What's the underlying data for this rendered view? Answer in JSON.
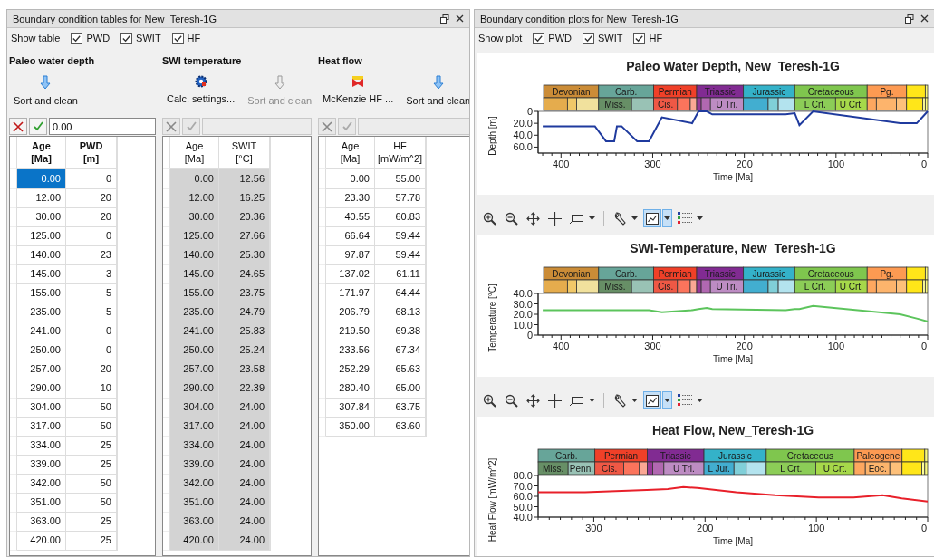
{
  "tables_panel": {
    "title": "Boundary condition tables for New_Teresh-1G",
    "show_label": "Show table",
    "toggles": [
      {
        "label": "PWD",
        "checked": true
      },
      {
        "label": "SWIT",
        "checked": true
      },
      {
        "label": "HF",
        "checked": true
      }
    ],
    "sections": [
      {
        "title": "Paleo water depth",
        "active": true,
        "readonly": false,
        "edit_value": "0.00",
        "buttons": [
          {
            "kind": "sort",
            "label": "Sort and clean",
            "disabled": false
          }
        ],
        "columns": [
          "Age\n[Ma]",
          "PWD\n[m]"
        ],
        "rows": [
          {
            "age": "0.00",
            "value": "0",
            "selected": true
          },
          {
            "age": "12.00",
            "value": "20",
            "selected": false
          },
          {
            "age": "30.00",
            "value": "20",
            "selected": false
          },
          {
            "age": "125.00",
            "value": "0",
            "selected": false
          },
          {
            "age": "140.00",
            "value": "23",
            "selected": false
          },
          {
            "age": "145.00",
            "value": "3",
            "selected": false
          },
          {
            "age": "155.00",
            "value": "5",
            "selected": false
          },
          {
            "age": "235.00",
            "value": "5",
            "selected": false
          },
          {
            "age": "241.00",
            "value": "0",
            "selected": false
          },
          {
            "age": "250.00",
            "value": "0",
            "selected": false
          },
          {
            "age": "257.00",
            "value": "20",
            "selected": false
          },
          {
            "age": "290.00",
            "value": "10",
            "selected": false
          },
          {
            "age": "304.00",
            "value": "50",
            "selected": false
          },
          {
            "age": "317.00",
            "value": "50",
            "selected": false
          },
          {
            "age": "334.00",
            "value": "25",
            "selected": false
          },
          {
            "age": "339.00",
            "value": "25",
            "selected": false
          },
          {
            "age": "342.00",
            "value": "50",
            "selected": false
          },
          {
            "age": "351.00",
            "value": "50",
            "selected": false
          },
          {
            "age": "363.00",
            "value": "25",
            "selected": false
          },
          {
            "age": "420.00",
            "value": "25",
            "selected": false
          }
        ]
      },
      {
        "title": "SWI temperature",
        "active": false,
        "readonly": true,
        "buttons": [
          {
            "kind": "settings",
            "label": "Calc. settings...",
            "disabled": false
          },
          {
            "kind": "sort",
            "label": "Sort and clean",
            "disabled": true
          }
        ],
        "columns": [
          "Age\n[Ma]",
          "SWIT\n[°C]"
        ],
        "rows": [
          {
            "age": "0.00",
            "value": "12.56",
            "selected": false
          },
          {
            "age": "12.00",
            "value": "16.25",
            "selected": false
          },
          {
            "age": "30.00",
            "value": "20.36",
            "selected": false
          },
          {
            "age": "125.00",
            "value": "27.66",
            "selected": false
          },
          {
            "age": "140.00",
            "value": "25.30",
            "selected": false
          },
          {
            "age": "145.00",
            "value": "24.65",
            "selected": false
          },
          {
            "age": "155.00",
            "value": "23.75",
            "selected": false
          },
          {
            "age": "235.00",
            "value": "24.79",
            "selected": false
          },
          {
            "age": "241.00",
            "value": "25.83",
            "selected": false
          },
          {
            "age": "250.00",
            "value": "25.24",
            "selected": false
          },
          {
            "age": "257.00",
            "value": "23.58",
            "selected": false
          },
          {
            "age": "290.00",
            "value": "22.39",
            "selected": false
          },
          {
            "age": "304.00",
            "value": "24.00",
            "selected": false
          },
          {
            "age": "317.00",
            "value": "24.00",
            "selected": false
          },
          {
            "age": "334.00",
            "value": "24.00",
            "selected": false
          },
          {
            "age": "339.00",
            "value": "24.00",
            "selected": false
          },
          {
            "age": "342.00",
            "value": "24.00",
            "selected": false
          },
          {
            "age": "351.00",
            "value": "24.00",
            "selected": false
          },
          {
            "age": "363.00",
            "value": "24.00",
            "selected": false
          },
          {
            "age": "420.00",
            "value": "24.00",
            "selected": false
          }
        ]
      },
      {
        "title": "Heat flow",
        "active": false,
        "readonly": false,
        "buttons": [
          {
            "kind": "mckenzie",
            "label": "McKenzie HF ...",
            "disabled": false
          },
          {
            "kind": "sort",
            "label": "Sort and clean",
            "disabled": false
          }
        ],
        "columns": [
          "Age\n[Ma]",
          "HF\n[mW/m^2]"
        ],
        "rows": [
          {
            "age": "0.00",
            "value": "55.00",
            "selected": false
          },
          {
            "age": "23.30",
            "value": "57.78",
            "selected": false
          },
          {
            "age": "40.55",
            "value": "60.83",
            "selected": false
          },
          {
            "age": "66.64",
            "value": "59.44",
            "selected": false
          },
          {
            "age": "97.87",
            "value": "59.44",
            "selected": false
          },
          {
            "age": "137.02",
            "value": "61.11",
            "selected": false
          },
          {
            "age": "171.97",
            "value": "64.44",
            "selected": false
          },
          {
            "age": "206.79",
            "value": "68.13",
            "selected": false
          },
          {
            "age": "219.50",
            "value": "69.38",
            "selected": false
          },
          {
            "age": "233.56",
            "value": "67.34",
            "selected": false
          },
          {
            "age": "252.29",
            "value": "65.63",
            "selected": false
          },
          {
            "age": "280.40",
            "value": "65.00",
            "selected": false
          },
          {
            "age": "307.84",
            "value": "63.75",
            "selected": false
          },
          {
            "age": "350.00",
            "value": "63.60",
            "selected": false
          }
        ]
      }
    ]
  },
  "plots_panel": {
    "title": "Boundary condition plots for New_Teresh-1G",
    "show_label": "Show plot",
    "toggles": [
      {
        "label": "PWD",
        "checked": true
      },
      {
        "label": "SWIT",
        "checked": true
      },
      {
        "label": "HF",
        "checked": true
      }
    ],
    "charts": [
      {
        "title": "Paleo Water Depth, New_Teresh-1G",
        "timescale": {
          "periods": [
            {
              "kind": "dev",
              "label": "Devonian",
              "color": "#cb8c37"
            },
            {
              "kind": "carb",
              "label": "Carb.",
              "color": "#67a599"
            },
            {
              "kind": "perm",
              "label": "Permian",
              "color": "#f04028"
            },
            {
              "kind": "trias",
              "label": "Triassic",
              "color": "#812b92"
            },
            {
              "kind": "jura",
              "label": "Jurassic",
              "color": "#34b2c9"
            },
            {
              "kind": "creta",
              "label": "Cretaceous",
              "color": "#7fc64e"
            },
            {
              "kind": "paleog",
              "label": "Pg.",
              "color": "#fd9a52"
            },
            {
              "kind": "neog",
              "color": "#ffe619"
            },
            {
              "kind": "quat",
              "color": "#f9f97f"
            }
          ],
          "epochs": [
            {
              "kind": "devl",
              "color": "#e5ac4d"
            },
            {
              "kind": "devm",
              "color": "#f1c868"
            },
            {
              "kind": "devu",
              "color": "#f1e19d"
            },
            {
              "kind": "miss",
              "label": "Miss.",
              "color": "#678f66"
            },
            {
              "kind": "penn",
              "color": "#99c2b5"
            },
            {
              "kind": "cisu",
              "label": "Cis.",
              "color": "#ef5845"
            },
            {
              "kind": "guad",
              "color": "#fb745c"
            },
            {
              "kind": "lopi",
              "color": "#fba794"
            },
            {
              "kind": "tril",
              "color": "#983999"
            },
            {
              "kind": "trim",
              "color": "#b168b1"
            },
            {
              "kind": "triu",
              "label": "U Tri.",
              "color": "#bd8cc3"
            },
            {
              "kind": "jurl",
              "color": "#42aed0"
            },
            {
              "kind": "jurm",
              "color": "#80cfd8"
            },
            {
              "kind": "juru",
              "color": "#b3e3ee"
            },
            {
              "kind": "crel",
              "label": "L Crt.",
              "color": "#8ccd57"
            },
            {
              "kind": "creu",
              "label": "U Crt.",
              "color": "#a6d84a"
            },
            {
              "kind": "paleoc",
              "color": "#fda75f"
            },
            {
              "kind": "eoc",
              "color": "#fdb46c"
            },
            {
              "kind": "olig",
              "color": "#fdc07a"
            },
            {
              "kind": "mioc",
              "color": "#ffe619"
            },
            {
              "kind": "plioc",
              "color": "#ffff99"
            },
            {
              "kind": "quat",
              "color": "#f9f97f"
            }
          ]
        },
        "chart_data": {
          "type": "line",
          "xlabel": "Time [Ma]",
          "ylabel": "Depth [m]",
          "x": [
            0,
            12,
            30,
            125,
            140,
            145,
            155,
            235,
            241,
            250,
            257,
            290,
            304,
            317,
            334,
            339,
            342,
            351,
            363,
            420
          ],
          "series": [
            {
              "color": "#1f3a9e",
              "values": [
                0,
                20,
                20,
                0,
                23,
                3,
                5,
                5,
                0,
                0,
                20,
                10,
                50,
                50,
                25,
                25,
                50,
                50,
                25,
                25
              ]
            }
          ],
          "xlim": [
            425,
            0
          ],
          "ylim": [
            70,
            0
          ],
          "xticks": [
            400,
            300,
            200,
            100,
            0
          ],
          "yticks": [
            0,
            {
              "value": 20,
              "label": "20.0"
            },
            {
              "value": 40,
              "label": "40.0"
            },
            {
              "value": 60,
              "label": "60.0"
            }
          ]
        }
      },
      {
        "title": "SWI-Temperature, New_Teresh-1G",
        "toolbar": [
          {
            "kind": "zoom_in",
            "selected": false
          },
          {
            "kind": "zoom_out",
            "selected": false
          },
          {
            "kind": "pan",
            "selected": false
          },
          {
            "kind": "crosshair",
            "selected": false
          },
          {
            "kind": "rectangle",
            "selected": false,
            "dropdown": true
          },
          {
            "kind": "tool",
            "selected": false,
            "dropdown": true
          },
          {
            "kind": "chart",
            "selected": true,
            "dropdown": true
          },
          {
            "kind": "legend",
            "selected": false,
            "dropdown": true
          }
        ],
        "timescale": {
          "periods": [
            {
              "kind": "dev",
              "label": "Devonian",
              "color": "#cb8c37"
            },
            {
              "kind": "carb",
              "label": "Carb.",
              "color": "#67a599"
            },
            {
              "kind": "perm",
              "label": "Permian",
              "color": "#f04028"
            },
            {
              "kind": "trias",
              "label": "Triassic",
              "color": "#812b92"
            },
            {
              "kind": "jura",
              "label": "Jurassic",
              "color": "#34b2c9"
            },
            {
              "kind": "creta",
              "label": "Cretaceous",
              "color": "#7fc64e"
            },
            {
              "kind": "paleog",
              "label": "Pg.",
              "color": "#fd9a52"
            },
            {
              "kind": "neog",
              "color": "#ffe619"
            },
            {
              "kind": "quat",
              "color": "#f9f97f"
            }
          ],
          "epochs": [
            {
              "kind": "devl",
              "color": "#e5ac4d"
            },
            {
              "kind": "devm",
              "color": "#f1c868"
            },
            {
              "kind": "devu",
              "color": "#f1e19d"
            },
            {
              "kind": "miss",
              "label": "Miss.",
              "color": "#678f66"
            },
            {
              "kind": "penn",
              "color": "#99c2b5"
            },
            {
              "kind": "cisu",
              "label": "Cis.",
              "color": "#ef5845"
            },
            {
              "kind": "guad",
              "color": "#fb745c"
            },
            {
              "kind": "lopi",
              "color": "#fba794"
            },
            {
              "kind": "tril",
              "color": "#983999"
            },
            {
              "kind": "trim",
              "color": "#b168b1"
            },
            {
              "kind": "triu",
              "label": "U Tri.",
              "color": "#bd8cc3"
            },
            {
              "kind": "jurl",
              "color": "#42aed0"
            },
            {
              "kind": "jurm",
              "color": "#80cfd8"
            },
            {
              "kind": "juru",
              "color": "#b3e3ee"
            },
            {
              "kind": "crel",
              "label": "L Crt.",
              "color": "#8ccd57"
            },
            {
              "kind": "creu",
              "label": "U Crt.",
              "color": "#a6d84a"
            },
            {
              "kind": "paleoc",
              "color": "#fda75f"
            },
            {
              "kind": "eoc",
              "color": "#fdb46c"
            },
            {
              "kind": "olig",
              "color": "#fdc07a"
            },
            {
              "kind": "mioc",
              "color": "#ffe619"
            },
            {
              "kind": "plioc",
              "color": "#ffff99"
            },
            {
              "kind": "quat",
              "color": "#f9f97f"
            }
          ]
        },
        "chart_data": {
          "type": "line",
          "xlabel": "Time [Ma]",
          "ylabel": "Temperature [°C]",
          "x": [
            0,
            12,
            30,
            125,
            140,
            145,
            155,
            235,
            241,
            250,
            257,
            290,
            304,
            317,
            334,
            339,
            342,
            351,
            363,
            420
          ],
          "series": [
            {
              "color": "#5cc45c",
              "values": [
                13,
                16,
                20,
                28,
                25,
                25,
                24,
                25,
                26,
                25,
                24,
                22,
                24,
                24,
                24,
                24,
                24,
                24,
                24,
                24
              ]
            }
          ],
          "xlim": [
            425,
            0
          ],
          "ylim": [
            0,
            40
          ],
          "xticks": [
            400,
            300,
            200,
            100,
            0
          ],
          "yticks": [
            0,
            {
              "value": 10,
              "label": "10.0"
            },
            {
              "value": 20,
              "label": "20.0"
            },
            {
              "value": 30,
              "label": "30.0"
            },
            {
              "value": 40,
              "label": "40.0"
            }
          ]
        }
      },
      {
        "title": "Heat Flow, New_Teresh-1G",
        "toolbar": [
          {
            "kind": "zoom_in",
            "selected": false
          },
          {
            "kind": "zoom_out",
            "selected": false
          },
          {
            "kind": "pan",
            "selected": false
          },
          {
            "kind": "crosshair",
            "selected": false
          },
          {
            "kind": "rectangle",
            "selected": false,
            "dropdown": true
          },
          {
            "kind": "tool",
            "selected": false,
            "dropdown": true
          },
          {
            "kind": "chart",
            "selected": true,
            "dropdown": true
          },
          {
            "kind": "legend",
            "selected": false,
            "dropdown": true
          }
        ],
        "timescale": {
          "periods": [
            {
              "kind": "carb",
              "label": "Carb.",
              "color": "#67a599"
            },
            {
              "kind": "perm",
              "label": "Permian",
              "color": "#f04028"
            },
            {
              "kind": "trias",
              "label": "Triassic",
              "color": "#812b92"
            },
            {
              "kind": "jura",
              "label": "Jurassic",
              "color": "#34b2c9"
            },
            {
              "kind": "creta",
              "label": "Cretaceous",
              "color": "#7fc64e"
            },
            {
              "kind": "paleog",
              "label": "Paleogene",
              "color": "#fd9a52"
            },
            {
              "kind": "neog",
              "color": "#ffe619"
            },
            {
              "kind": "quat",
              "color": "#f9f97f"
            }
          ],
          "epochs": [
            {
              "kind": "miss",
              "label": "Miss.",
              "color": "#678f66"
            },
            {
              "kind": "penn",
              "label": "Penn.",
              "color": "#99c2b5"
            },
            {
              "kind": "cisu",
              "label": "Cis.",
              "color": "#ef5845"
            },
            {
              "kind": "guad",
              "color": "#fb745c"
            },
            {
              "kind": "lopi",
              "color": "#fba794"
            },
            {
              "kind": "tril",
              "color": "#983999"
            },
            {
              "kind": "trim",
              "color": "#b168b1"
            },
            {
              "kind": "triu",
              "label": "U Tri.",
              "color": "#bd8cc3"
            },
            {
              "kind": "jurl",
              "label": "L Jur.",
              "color": "#42aed0"
            },
            {
              "kind": "jurm",
              "color": "#80cfd8"
            },
            {
              "kind": "juru",
              "color": "#b3e3ee"
            },
            {
              "kind": "crel",
              "label": "L Crt.",
              "color": "#8ccd57"
            },
            {
              "kind": "creu",
              "label": "U Crt.",
              "color": "#a6d84a"
            },
            {
              "kind": "paleoc",
              "color": "#fda75f"
            },
            {
              "kind": "eoc",
              "label": "Eoc.",
              "color": "#fdb46c"
            },
            {
              "kind": "olig",
              "color": "#fdc07a"
            },
            {
              "kind": "mioc",
              "color": "#ffe619"
            },
            {
              "kind": "plioc",
              "color": "#ffff99"
            },
            {
              "kind": "quat",
              "color": "#f9f97f"
            }
          ]
        },
        "chart_data": {
          "type": "line",
          "xlabel": "Time [Ma]",
          "ylabel": "Heat Flow [mW/m^2]",
          "x": [
            0,
            23.3,
            40.55,
            66.64,
            97.87,
            137.02,
            171.97,
            206.79,
            219.5,
            233.56,
            252.29,
            280.4,
            307.84,
            350
          ],
          "series": [
            {
              "color": "#e8202a",
              "values": [
                55,
                58,
                61,
                59,
                59,
                61,
                64,
                68,
                69,
                67,
                66,
                65,
                64,
                64
              ]
            }
          ],
          "xlim": [
            350,
            0
          ],
          "ylim": [
            40,
            80
          ],
          "xticks": [
            300,
            200,
            100,
            0
          ],
          "yticks": [
            {
              "value": 40,
              "label": "40.0"
            },
            {
              "value": 50,
              "label": "50.0"
            },
            {
              "value": 60,
              "label": "60.0"
            },
            {
              "value": 70,
              "label": "70.0"
            },
            {
              "value": 80,
              "label": "80.0"
            }
          ]
        }
      }
    ]
  }
}
